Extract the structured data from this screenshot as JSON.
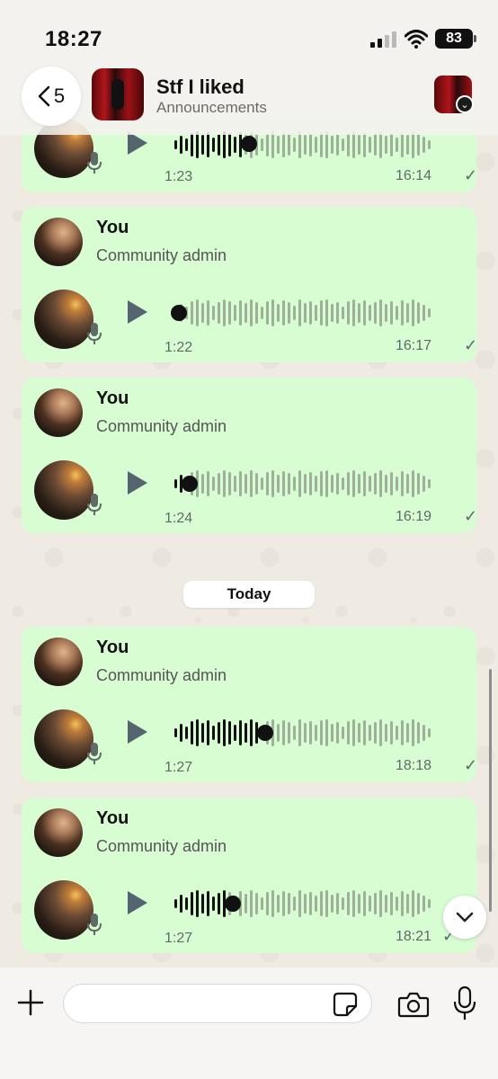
{
  "status_bar": {
    "time": "18:27",
    "battery": "83"
  },
  "header": {
    "back_count": "5",
    "title": "Stf I liked",
    "subtitle": "Announcements"
  },
  "messages": [
    {
      "sender": "",
      "role": "",
      "duration": "1:23",
      "time": "16:14",
      "progress": 0.28
    },
    {
      "sender": "You",
      "role": "Community admin",
      "duration": "1:22",
      "time": "16:17",
      "progress": 0.0
    },
    {
      "sender": "You",
      "role": "Community admin",
      "duration": "1:24",
      "time": "16:19",
      "progress": 0.04
    },
    {
      "sender": "You",
      "role": "Community admin",
      "duration": "1:27",
      "time": "18:18",
      "progress": 0.34
    },
    {
      "sender": "You",
      "role": "Community admin",
      "duration": "1:27",
      "time": "18:21",
      "progress": 0.21
    }
  ],
  "date_separator": "Today",
  "composer": {
    "placeholder": ""
  },
  "colors": {
    "bubble": "#d9fdd3",
    "background": "#efeae2",
    "play": "#54656f"
  }
}
